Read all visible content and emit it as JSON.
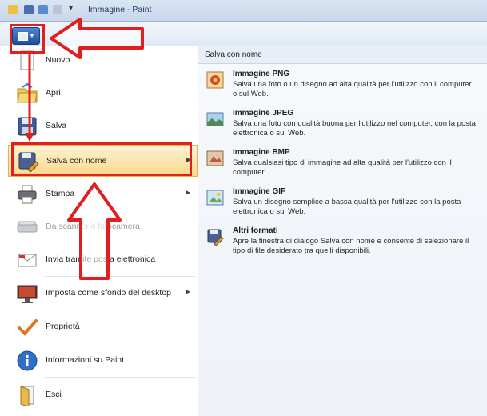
{
  "window": {
    "title": "Immagine - Paint"
  },
  "file_button": {
    "icon": "paint-menu-icon"
  },
  "menu": {
    "items": [
      {
        "label": "Nuovo",
        "icon": "new-icon"
      },
      {
        "label": "Apri",
        "icon": "open-folder-icon"
      },
      {
        "label": "Salva",
        "icon": "save-floppy-icon"
      },
      {
        "label": "Salva con nome",
        "icon": "save-as-icon",
        "submenu": true,
        "selected": true
      },
      {
        "label": "Stampa",
        "icon": "printer-icon",
        "submenu": true
      },
      {
        "label": "Da scanner o fotocamera",
        "icon": "scanner-icon",
        "disabled": true
      },
      {
        "label": "Invia tramite posta elettronica",
        "icon": "email-icon"
      },
      {
        "label": "Imposta come sfondo del desktop",
        "icon": "desktop-background-icon",
        "submenu": true
      },
      {
        "label": "Proprietà",
        "icon": "checkmark-icon"
      },
      {
        "label": "Informazioni su Paint",
        "icon": "info-icon"
      },
      {
        "label": "Esci",
        "icon": "exit-icon"
      }
    ]
  },
  "panel": {
    "header": "Salva con nome",
    "options": [
      {
        "title": "Immagine PNG",
        "desc": "Salva una foto o un disegno ad alta qualità per l'utilizzo con il computer o sul Web.",
        "icon": "png-image-icon"
      },
      {
        "title": "Immagine JPEG",
        "desc": "Salva una foto con qualità buona per l'utilizzo nel computer, con la posta elettronica o sul Web.",
        "icon": "jpeg-image-icon"
      },
      {
        "title": "Immagine BMP",
        "desc": "Salva qualsiasi tipo di immagine ad alta qualità per l'utilizzo con il computer.",
        "icon": "bmp-image-icon"
      },
      {
        "title": "Immagine GIF",
        "desc": "Salva un disegno semplice a bassa qualità per l'utilizzo con la posta elettronica o sul Web.",
        "icon": "gif-image-icon"
      },
      {
        "title": "Altri formati",
        "desc": "Apre la finestra di dialogo Salva con nome e consente di selezionare il tipo di file desiderato tra quelli disponibili.",
        "icon": "other-formats-icon"
      }
    ]
  },
  "colors": {
    "annotation_red": "#e0201e",
    "selected_bg": "#fbd98a",
    "ribbon_blue": "#1d4f9e"
  }
}
